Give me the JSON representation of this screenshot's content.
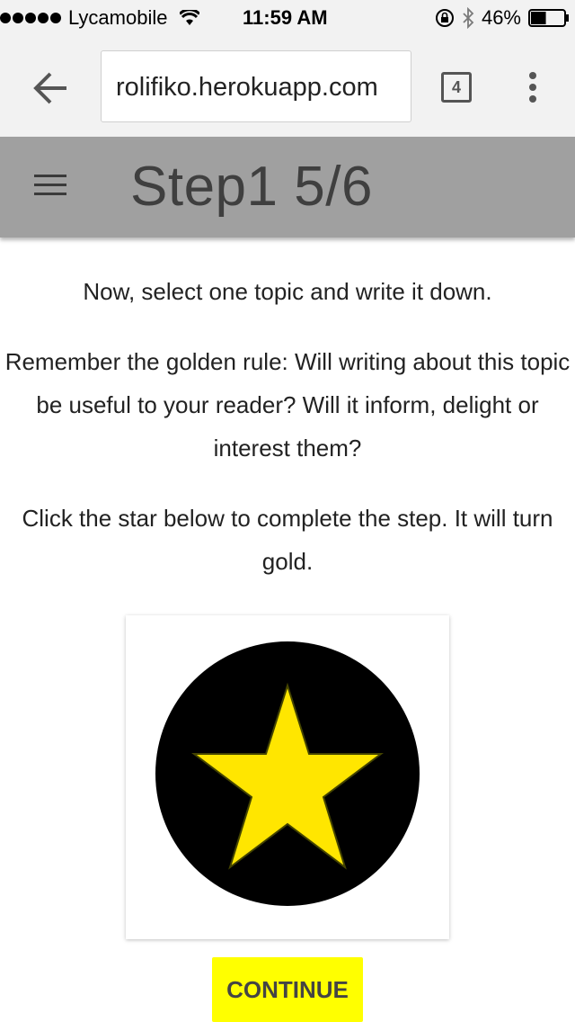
{
  "status_bar": {
    "carrier": "Lycamobile",
    "time": "11:59 AM",
    "battery_percent": "46%",
    "battery_level": 0.46,
    "signal_bars": 5
  },
  "browser": {
    "url": "rolifiko.herokuapp.com",
    "tab_count": "4",
    "icons": [
      "back-arrow-icon",
      "tabs-icon",
      "overflow-menu-icon"
    ]
  },
  "header": {
    "title": "Step1 5/6",
    "background_color": "#a0a0a0",
    "menu_icon": "hamburger-icon"
  },
  "instructions": {
    "line1": "Now, select one topic and write it down.",
    "line2": "Remember the golden rule: Will writing about this topic be useful to your reader? Will it inform, delight or interest them?",
    "line3": "Click the star below to complete the step. It will turn gold."
  },
  "star": {
    "icon": "star-icon",
    "circle_color": "#000000",
    "star_color": "#ffe600"
  },
  "continue_button": {
    "label": "CONTINUE",
    "background_color": "#ffff00"
  }
}
